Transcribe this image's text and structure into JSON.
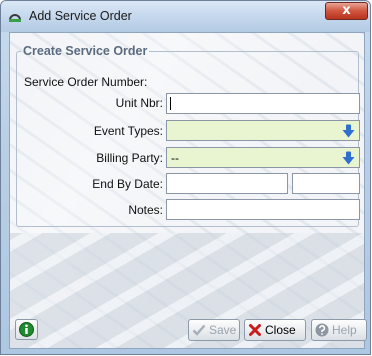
{
  "window": {
    "title": "Add Service Order",
    "close_glyph": "x"
  },
  "form": {
    "group_label": "Create Service Order",
    "fields": {
      "service_order_number": {
        "label": "Service Order Number:",
        "value": ""
      },
      "unit_nbr": {
        "label": "Unit Nbr:",
        "value": ""
      },
      "event_types": {
        "label": "Event Types:",
        "value": ""
      },
      "billing_party": {
        "label": "Billing Party:",
        "value": "--"
      },
      "end_by_date": {
        "label": "End By Date:",
        "date_value": "",
        "time_value": ""
      },
      "notes": {
        "label": "Notes:",
        "value": ""
      }
    }
  },
  "footer": {
    "save_label": "Save",
    "close_label": "Close",
    "help_label": "Help"
  },
  "colors": {
    "required_field_bg": "#e9f5d0",
    "dropdown_arrow": "#2f6fd1",
    "info_icon": "#1f8a2e",
    "close_icon": "#cc1b1b"
  },
  "icons": {
    "app": "app-icon",
    "info": "info-icon",
    "save": "check-icon",
    "close": "x-icon",
    "help": "question-icon",
    "dropdown": "arrow-down-icon"
  }
}
